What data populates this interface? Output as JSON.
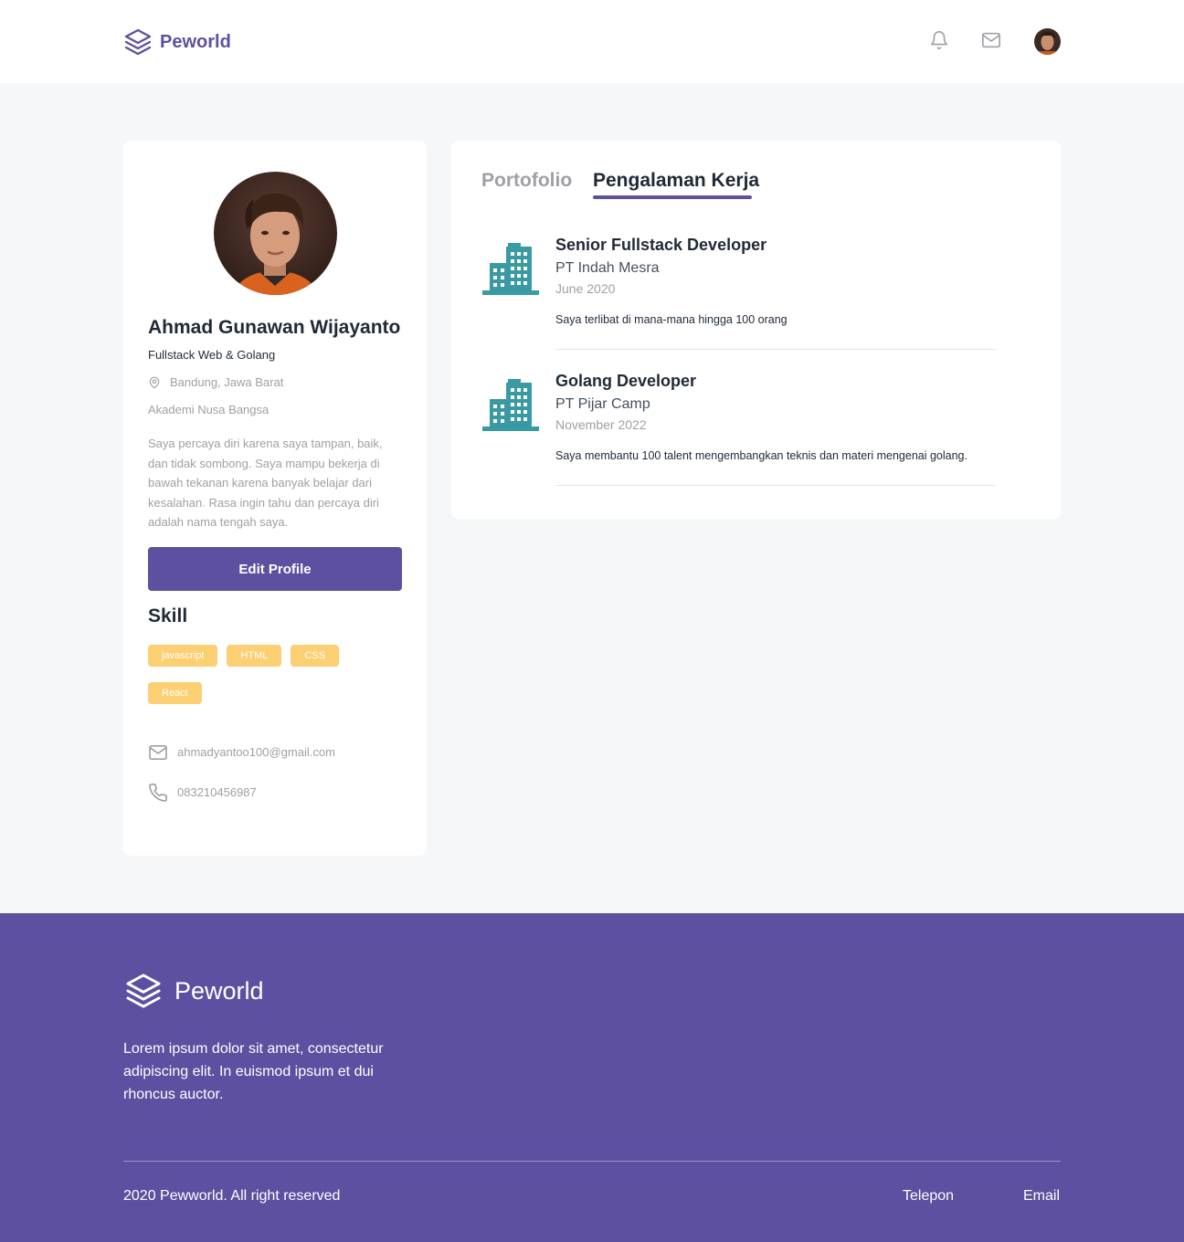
{
  "brand": {
    "name": "Peworld",
    "color": "#5E50A1"
  },
  "navbar": {
    "icons": [
      "bell-icon",
      "mail-icon"
    ],
    "avatar": "user-avatar"
  },
  "profile": {
    "name": "Ahmad Gunawan Wijayanto",
    "job": "Fullstack Web & Golang",
    "location": "Bandung, Jawa Barat",
    "company": "Akademi Nusa Bangsa",
    "bio": "Saya percaya diri karena saya tampan, baik, dan tidak sombong. Saya mampu bekerja di bawah tekanan karena banyak belajar dari kesalahan. Rasa ingin tahu dan percaya diri adalah nama tengah saya.",
    "edit_label": "Edit Profile",
    "skill_title": "Skill",
    "skills": [
      "javascript",
      "HTML",
      "CSS",
      "React"
    ],
    "email": "ahmadyantoo100@gmail.com",
    "phone": "083210456987"
  },
  "tabs": {
    "portfolio": "Portofolio",
    "experience": "Pengalaman Kerja"
  },
  "experiences": [
    {
      "position": "Senior Fullstack Developer",
      "company": "PT Indah Mesra",
      "date": "June 2020",
      "description": "Saya terlibat di mana-mana hingga 100 orang"
    },
    {
      "position": "Golang Developer",
      "company": "PT Pijar Camp",
      "date": "November 2022",
      "description": "Saya membantu 100 talent mengembangkan teknis dan materi mengenai golang."
    }
  ],
  "footer": {
    "brand": "Peworld",
    "description": "Lorem ipsum dolor sit amet, consectetur adipiscing elit. In euismod ipsum et dui rhoncus auctor.",
    "copyright": "2020 Pewworld. All right reserved",
    "links": {
      "phone": "Telepon",
      "email": "Email"
    }
  },
  "colors": {
    "accent": "#5E50A1",
    "skill": "#FBB017",
    "building": "#3A9AA3"
  }
}
